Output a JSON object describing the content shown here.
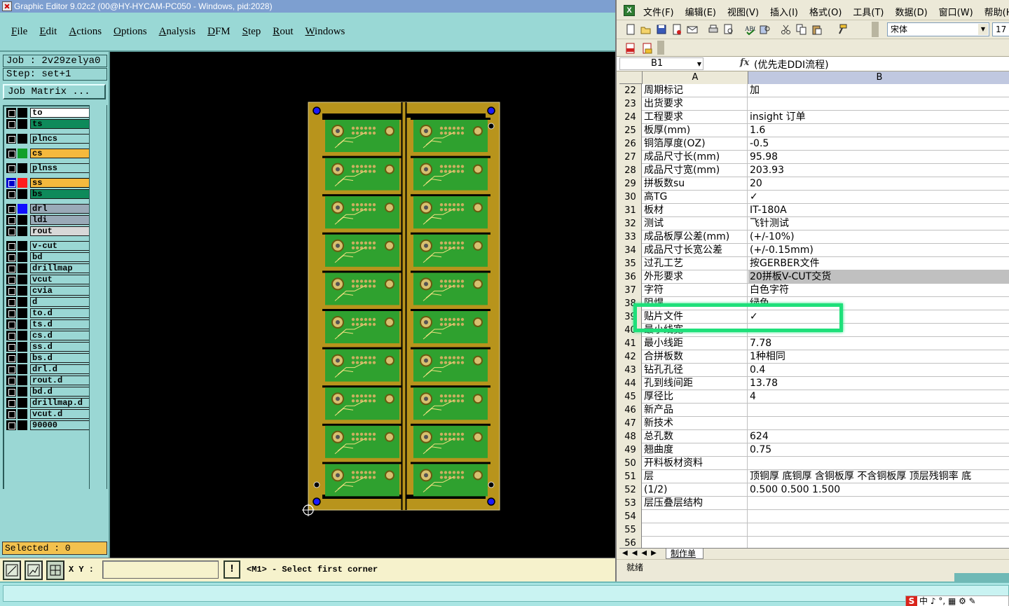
{
  "editor": {
    "title": "Graphic Editor 9.02c2 (00@HY-HYCAM-PC050 - Windows, pid:2028)",
    "menu": [
      "File",
      "Edit",
      "Actions",
      "Options",
      "Analysis",
      "DFM",
      "Step",
      "Rout",
      "Windows"
    ],
    "job": "Job : 2v29zelya0",
    "step": "Step: set+1",
    "job_matrix": "Job Matrix ...",
    "layers": [
      {
        "name": "to",
        "color": "#ffffff",
        "swatch": "#000000"
      },
      {
        "name": "ts",
        "color": "#0e8a5a",
        "swatch": "#000000"
      },
      {
        "name": "plncs",
        "color": "#9ad7d4",
        "swatch": "#000000"
      },
      {
        "name": "cs",
        "color": "#f5b93d",
        "swatch": "#11a02a"
      },
      {
        "name": "plnss",
        "color": "#9ad7d4",
        "swatch": "#000000"
      },
      {
        "name": "ss",
        "color": "#f5b93d",
        "swatch": "#ff1e1e",
        "active": true
      },
      {
        "name": "bs",
        "color": "#0e8a5a",
        "swatch": "#000000"
      },
      {
        "name": "drl",
        "color": "#9aaab8",
        "swatch": "#1010ff"
      },
      {
        "name": "ldi",
        "color": "#9aaab8",
        "swatch": "#000000"
      },
      {
        "name": "rout",
        "color": "#d8d8d8",
        "swatch": "#000000"
      },
      {
        "name": "v-cut",
        "color": "#9ad7d4",
        "swatch": "#000000"
      },
      {
        "name": "bd",
        "color": "#9ad7d4",
        "swatch": "#000000"
      },
      {
        "name": "drillmap",
        "color": "#9ad7d4",
        "swatch": "#000000"
      },
      {
        "name": "vcut",
        "color": "#9ad7d4",
        "swatch": "#000000"
      },
      {
        "name": "cvia",
        "color": "#9ad7d4",
        "swatch": "#000000"
      },
      {
        "name": "d",
        "color": "#9ad7d4",
        "swatch": "#000000"
      },
      {
        "name": "to.d",
        "color": "#9ad7d4",
        "swatch": "#000000"
      },
      {
        "name": "ts.d",
        "color": "#9ad7d4",
        "swatch": "#000000"
      },
      {
        "name": "cs.d",
        "color": "#9ad7d4",
        "swatch": "#000000"
      },
      {
        "name": "ss.d",
        "color": "#9ad7d4",
        "swatch": "#000000"
      },
      {
        "name": "bs.d",
        "color": "#9ad7d4",
        "swatch": "#000000"
      },
      {
        "name": "drl.d",
        "color": "#9ad7d4",
        "swatch": "#000000"
      },
      {
        "name": "rout.d",
        "color": "#9ad7d4",
        "swatch": "#000000"
      },
      {
        "name": "bd.d",
        "color": "#9ad7d4",
        "swatch": "#000000"
      },
      {
        "name": "drillmap.d",
        "color": "#9ad7d4",
        "swatch": "#000000"
      },
      {
        "name": "vcut.d",
        "color": "#9ad7d4",
        "swatch": "#000000"
      },
      {
        "name": "90000",
        "color": "#9ad7d4",
        "swatch": "#000000"
      }
    ],
    "selected": "Selected : 0",
    "xy_label": "X Y :",
    "xy_value": "",
    "status_message": "<M1> - Select first corner",
    "panel": {
      "rows": 10,
      "cols": 2,
      "board_color": "#2fa12f",
      "frame_color": "#b8941c"
    }
  },
  "excel": {
    "menu": [
      "文件(F)",
      "编辑(E)",
      "视图(V)",
      "插入(I)",
      "格式(O)",
      "工具(T)",
      "数据(D)",
      "窗口(W)",
      "帮助(H)"
    ],
    "font_name": "宋体",
    "font_size": "17",
    "name_box": "B1",
    "formula": "(优先走DDI流程)",
    "columns": [
      "A",
      "B"
    ],
    "rows": [
      {
        "n": "22",
        "a": "周期标记",
        "b": "加"
      },
      {
        "n": "23",
        "a": "出货要求",
        "b": ""
      },
      {
        "n": "24",
        "a": "工程要求",
        "b": "insight 订单"
      },
      {
        "n": "25",
        "a": "板厚(mm)",
        "b": "1.6"
      },
      {
        "n": "26",
        "a": "铜箔厚度(OZ)",
        "b": "-0.5"
      },
      {
        "n": "27",
        "a": "成品尺寸长(mm)",
        "b": "95.98"
      },
      {
        "n": "28",
        "a": "成品尺寸宽(mm)",
        "b": "203.93"
      },
      {
        "n": "29",
        "a": "拼板数su",
        "b": "20"
      },
      {
        "n": "30",
        "a": "高TG",
        "b": "✓"
      },
      {
        "n": "31",
        "a": "板材",
        "b": "IT-180A"
      },
      {
        "n": "32",
        "a": "测试",
        "b": "飞针测试"
      },
      {
        "n": "33",
        "a": "成品板厚公差(mm)",
        "b": "(+/-10%)"
      },
      {
        "n": "34",
        "a": "成品尺寸长宽公差",
        "b": "(+/-0.15mm)"
      },
      {
        "n": "35",
        "a": "过孔工艺",
        "b": "按GERBER文件"
      },
      {
        "n": "36",
        "a": "外形要求",
        "b": "20拼板V-CUT交货",
        "hl": true
      },
      {
        "n": "37",
        "a": "字符",
        "b": "白色字符"
      },
      {
        "n": "38",
        "a": "阻焊",
        "b": "绿色"
      },
      {
        "n": "39",
        "a": "贴片文件",
        "b": "✓"
      },
      {
        "n": "40",
        "a": "最小线宽",
        "b": ""
      },
      {
        "n": "41",
        "a": "最小线距",
        "b": "7.78"
      },
      {
        "n": "42",
        "a": "合拼板数",
        "b": "1种相同"
      },
      {
        "n": "43",
        "a": "钻孔孔径",
        "b": "0.4"
      },
      {
        "n": "44",
        "a": "孔到线间距",
        "b": "13.78"
      },
      {
        "n": "45",
        "a": "厚径比",
        "b": "4"
      },
      {
        "n": "46",
        "a": "新产品",
        "b": ""
      },
      {
        "n": "47",
        "a": "新技术",
        "b": ""
      },
      {
        "n": "48",
        "a": "总孔数",
        "b": "624"
      },
      {
        "n": "49",
        "a": "翘曲度",
        "b": "0.75"
      },
      {
        "n": "50",
        "a": "开料板材资料",
        "b": ""
      },
      {
        "n": "51",
        "a": "层",
        "b": "顶铜厚 底铜厚 含铜板厚 不含铜板厚 顶层残铜率 底"
      },
      {
        "n": "52",
        "a": "(1/2)",
        "b": "0.500  0.500   1.500"
      },
      {
        "n": "53",
        "a": "层压叠层结构",
        "b": ""
      },
      {
        "n": "54",
        "a": "",
        "b": ""
      },
      {
        "n": "55",
        "a": "",
        "b": ""
      },
      {
        "n": "56",
        "a": "",
        "b": ""
      }
    ],
    "sheet_tab": "制作单",
    "status": "就绪",
    "ime_label": "中",
    "ime_logo": "S"
  }
}
